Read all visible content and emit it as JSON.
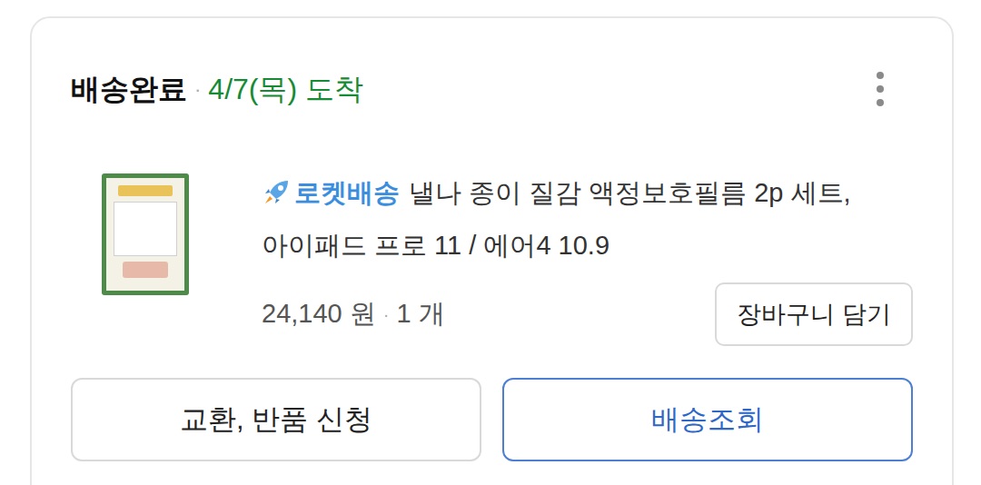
{
  "status": {
    "label": "배송완료",
    "separator": "·",
    "arrival": "4/7(목) 도착"
  },
  "product": {
    "badge": "로켓배송",
    "title_lines": [
      "낼나 종이 질감 액정보호필름 2p 세트,",
      "아이패드 프로 11 / 에어4 10.9"
    ],
    "price": "24,140 원",
    "separator": "·",
    "quantity": "1 개"
  },
  "buttons": {
    "add_to_cart": "장바구니 담기",
    "exchange_return": "교환, 반품 신청",
    "track": "배송조회"
  }
}
